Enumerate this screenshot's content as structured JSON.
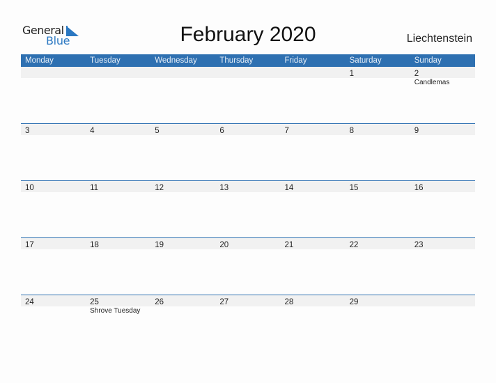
{
  "logo": {
    "general": "General",
    "blue": "Blue",
    "icon": "flag-triangle-icon",
    "accent": "#2b78c2"
  },
  "title": "February 2020",
  "country": "Liechtenstein",
  "header_color": "#2e70b1",
  "weekdays": [
    "Monday",
    "Tuesday",
    "Wednesday",
    "Thursday",
    "Friday",
    "Saturday",
    "Sunday"
  ],
  "weeks": [
    [
      {
        "day": ""
      },
      {
        "day": ""
      },
      {
        "day": ""
      },
      {
        "day": ""
      },
      {
        "day": ""
      },
      {
        "day": "1"
      },
      {
        "day": "2",
        "holiday": "Candlemas"
      }
    ],
    [
      {
        "day": "3"
      },
      {
        "day": "4"
      },
      {
        "day": "5"
      },
      {
        "day": "6"
      },
      {
        "day": "7"
      },
      {
        "day": "8"
      },
      {
        "day": "9"
      }
    ],
    [
      {
        "day": "10"
      },
      {
        "day": "11"
      },
      {
        "day": "12"
      },
      {
        "day": "13"
      },
      {
        "day": "14"
      },
      {
        "day": "15"
      },
      {
        "day": "16"
      }
    ],
    [
      {
        "day": "17"
      },
      {
        "day": "18"
      },
      {
        "day": "19"
      },
      {
        "day": "20"
      },
      {
        "day": "21"
      },
      {
        "day": "22"
      },
      {
        "day": "23"
      }
    ],
    [
      {
        "day": "24"
      },
      {
        "day": "25",
        "holiday": "Shrove Tuesday"
      },
      {
        "day": "26"
      },
      {
        "day": "27"
      },
      {
        "day": "28"
      },
      {
        "day": "29"
      },
      {
        "day": ""
      }
    ]
  ]
}
